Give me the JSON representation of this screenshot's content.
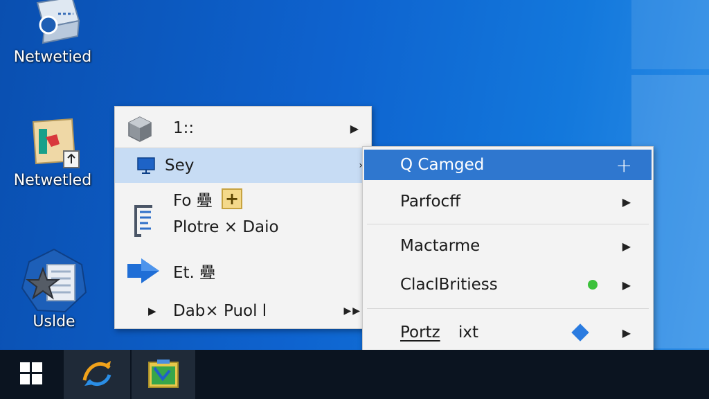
{
  "desktop": {
    "icons": [
      {
        "label": "Netwetied",
        "icon": "network-folder-icon"
      },
      {
        "label": "Netwetled",
        "icon": "document-shortcut-icon"
      },
      {
        "label": "Uslde",
        "icon": "star-badge-icon"
      }
    ]
  },
  "context_menu": {
    "items": [
      {
        "label": "1::",
        "icon": "cube-icon",
        "has_submenu": true
      },
      {
        "label": "Sey",
        "icon": "monitor-icon",
        "has_submenu": true,
        "highlighted": true
      },
      {
        "label": "Fo 疉",
        "icon": "plus-badge-icon"
      },
      {
        "label": "Plotre × Daio",
        "icon": "document-lines-icon"
      },
      {
        "label": "Et. 疉",
        "icon": "arrow-right-icon"
      },
      {
        "label": "Dab× Puol l",
        "has_submenu": true
      }
    ]
  },
  "submenu": {
    "items": [
      {
        "label": "Q Camged",
        "trailing": "+",
        "highlighted": true
      },
      {
        "label": "Parfocff",
        "has_submenu": true
      },
      {
        "label": "Mactarme",
        "has_submenu": true
      },
      {
        "label": "ClaclBritiess",
        "has_submenu": true,
        "indicator": "green-dot-icon"
      },
      {
        "label_a": "Portz",
        "label_b": "ixt",
        "has_submenu": true,
        "indicator": "blue-diamond-icon"
      }
    ]
  },
  "colors": {
    "highlight_main": "#c7dcf4",
    "highlight_sub": "#2f77cf",
    "status_green": "#3cc13b",
    "accent_blue": "#2a7be0"
  },
  "taskbar": {
    "buttons": [
      "windows-start-icon",
      "edge-refresh-icon",
      "photo-app-icon"
    ]
  }
}
